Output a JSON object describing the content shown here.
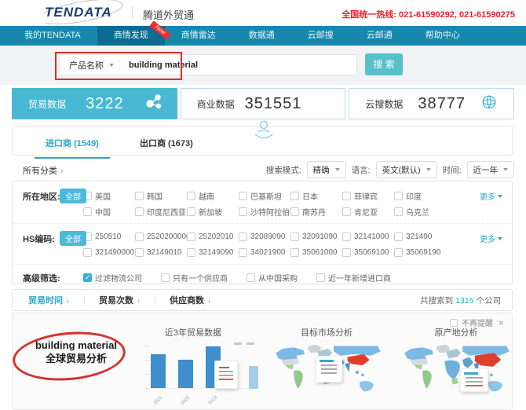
{
  "header": {
    "logo_text": "TENDATA",
    "brand": "腾道外贸通",
    "hotline": "全国统一热线: 021-61590292, 021-61590275"
  },
  "nav": {
    "items": [
      {
        "label": "我的TENDATA",
        "active": false
      },
      {
        "label": "商情发现",
        "active": true,
        "badge": "New"
      },
      {
        "label": "商情雷达",
        "active": false
      },
      {
        "label": "数据通",
        "active": false
      },
      {
        "label": "云邮搜",
        "active": false
      },
      {
        "label": "云邮通",
        "active": false
      },
      {
        "label": "帮助中心",
        "active": false
      }
    ]
  },
  "search": {
    "category": "产品名称",
    "query": "building material",
    "button_label": "搜 索"
  },
  "stats": {
    "items": [
      {
        "label": "贸易数据",
        "value": "3222",
        "icon": "molecule-icon",
        "active": true
      },
      {
        "label": "商业数据",
        "value": "351551",
        "icon": "",
        "active": false
      },
      {
        "label": "云搜数据",
        "value": "38777",
        "icon": "globe-icon",
        "active": false
      }
    ]
  },
  "tabs": [
    {
      "label": "进口商",
      "count": "(1549)",
      "active": true
    },
    {
      "label": "出口商",
      "count": "(1673)",
      "active": false
    }
  ],
  "toolbar": {
    "all_categories": "所有分类",
    "chevron": "›",
    "search_mode_label": "搜索模式:",
    "search_mode_value": "精确",
    "language_label": "语言:",
    "language_value": "英文(默认)",
    "time_label": "时间:",
    "time_value": "近一年"
  },
  "filters": {
    "region": {
      "label": "所在地区:",
      "all_button": "全部",
      "more_link": "更多",
      "rows": [
        [
          "美国",
          "韩国",
          "越南",
          "巴基斯坦",
          "日本",
          "菲律宾",
          "印度"
        ],
        [
          "中国",
          "印度尼西亚",
          "新加坡",
          "沙特阿拉伯",
          "南苏丹",
          "肯尼亚",
          "乌克兰"
        ]
      ]
    },
    "hs_code": {
      "label": "HS编码:",
      "all_button": "全部",
      "more_link": "更多",
      "rows": [
        [
          "250510",
          "2520200000",
          "25202010",
          "32089090",
          "32091090",
          "32141000",
          "321490"
        ],
        [
          "321490000...",
          "32149010",
          "32149090",
          "34021900",
          "35061000",
          "35069100",
          "35069190"
        ]
      ]
    },
    "advanced": {
      "label": "高级筛选:",
      "options": [
        {
          "label": "过滤物流公司",
          "checked": true
        },
        {
          "label": "只有一个供应商",
          "checked": false
        },
        {
          "label": "从中国采购",
          "checked": false
        },
        {
          "label": "近一年新增进口商",
          "checked": false
        }
      ]
    }
  },
  "sort": {
    "items": [
      {
        "label": "贸易时间",
        "active": true
      },
      {
        "label": "贸易次数",
        "active": false
      },
      {
        "label": "供应商数",
        "active": false
      }
    ],
    "result_text_prefix": "共搜索到",
    "result_count": "1315",
    "result_text_suffix": "个公司"
  },
  "preview": {
    "dismiss_label": "不再提醒",
    "close": "×",
    "query_title_line1": "building material",
    "query_title_line2": "全球贸易分析",
    "panel_titles": [
      "近3年贸易数据",
      "目标市场分析",
      "原产地分析"
    ]
  },
  "chart_data": {
    "type": "bar",
    "title": "近3年贸易数据",
    "categories": [
      "2021",
      "2022",
      "2023"
    ],
    "values": [
      62,
      51,
      75
    ],
    "ylim": [
      0,
      80
    ],
    "bar_color": "#3f8fcc",
    "legend_position": "top-right",
    "x_tick_rotation": -45
  },
  "colors": {
    "nav_bg": "#1787ad",
    "nav_active_bg": "#0b6b92",
    "accent_teal": "#49b8d3",
    "button_teal": "#58c1cc",
    "link_teal": "#2aa7c7",
    "hotline_red": "#ef1f30",
    "annotation_red": "#d3322b",
    "bar_blue": "#3f8fcc",
    "map_red": "#e03e2d"
  }
}
